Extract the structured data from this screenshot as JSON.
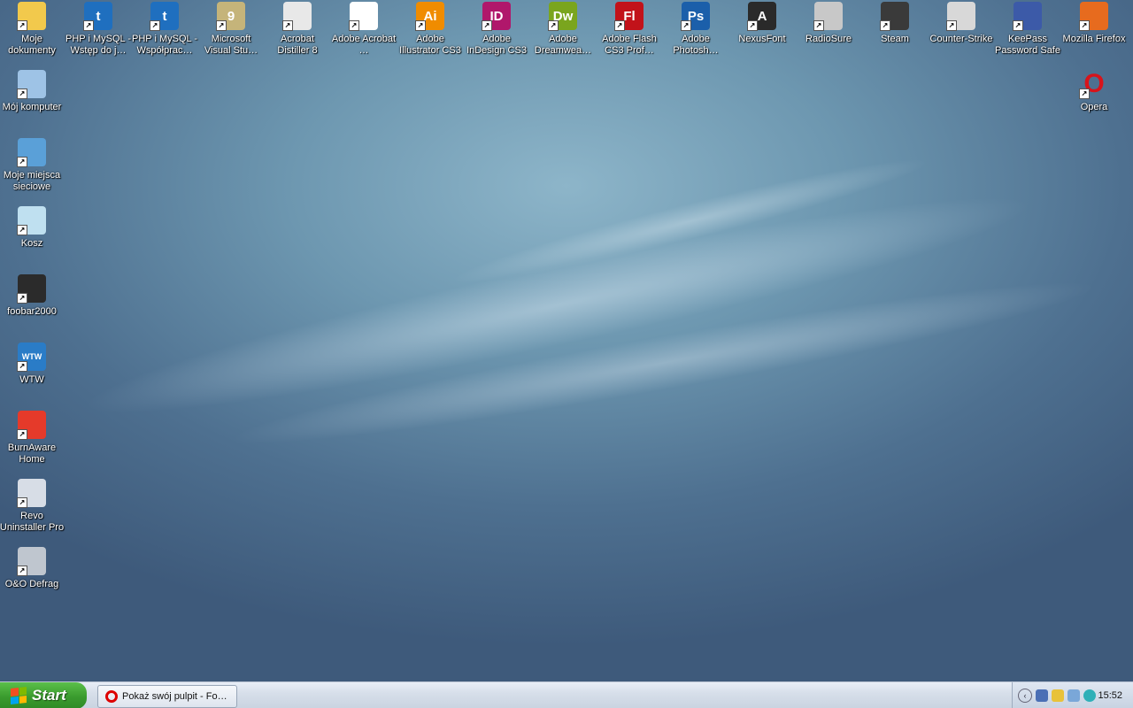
{
  "desktop": {
    "icons_top": [
      {
        "label": "Moje dokumenty",
        "icon": "folder-icon",
        "color": "#f2c94c",
        "text": ""
      },
      {
        "label": "PHP i MySQL - Wstęp do j…",
        "icon": "book-t-icon",
        "color": "#1f6fbf",
        "text": "t"
      },
      {
        "label": "PHP i MySQL - Współprac…",
        "icon": "book-t-icon",
        "color": "#1f6fbf",
        "text": "t"
      },
      {
        "label": "Microsoft Visual Stu…",
        "icon": "visual-studio-icon",
        "color": "#c5b47a",
        "text": "9"
      },
      {
        "label": "Acrobat Distiller 8",
        "icon": "acrobat-distiller-icon",
        "color": "#e8e8e8",
        "text": ""
      },
      {
        "label": "Adobe Acrobat …",
        "icon": "acrobat-icon",
        "color": "#ffffff",
        "text": ""
      },
      {
        "label": "Adobe Illustrator CS3",
        "icon": "illustrator-icon",
        "color": "#f08c00",
        "text": "Ai"
      },
      {
        "label": "Adobe InDesign CS3",
        "icon": "indesign-icon",
        "color": "#b0176b",
        "text": "ID"
      },
      {
        "label": "Adobe Dreamwea…",
        "icon": "dreamweaver-icon",
        "color": "#7aa51e",
        "text": "Dw"
      },
      {
        "label": "Adobe Flash CS3 Prof…",
        "icon": "flash-icon",
        "color": "#c2121a",
        "text": "Fl"
      },
      {
        "label": "Adobe Photosh…",
        "icon": "photoshop-icon",
        "color": "#1b5faa",
        "text": "Ps"
      },
      {
        "label": "NexusFont",
        "icon": "nexusfont-icon",
        "color": "#2a2a2a",
        "text": "A"
      },
      {
        "label": "RadioSure",
        "icon": "speaker-icon",
        "color": "#c8c8c8",
        "text": ""
      },
      {
        "label": "Steam",
        "icon": "steam-icon",
        "color": "#3a3a3a",
        "text": ""
      },
      {
        "label": "Counter-Strike",
        "icon": "counter-strike-icon",
        "color": "#d8d8d8",
        "text": ""
      },
      {
        "label": "KeePass Password Safe",
        "icon": "lock-icon",
        "color": "#3c5aa8",
        "text": ""
      },
      {
        "label": "Mozilla Firefox",
        "icon": "firefox-icon",
        "color": "#e76b1e",
        "text": ""
      }
    ],
    "icons_left": [
      {
        "label": "Mój komputer",
        "icon": "computer-icon",
        "color": "#9ec3e6",
        "text": ""
      },
      {
        "label": "Moje miejsca sieciowe",
        "icon": "network-icon",
        "color": "#5aa0d8",
        "text": ""
      },
      {
        "label": "Kosz",
        "icon": "recycle-bin-icon",
        "color": "#bfe0f0",
        "text": ""
      },
      {
        "label": "foobar2000",
        "icon": "foobar-icon",
        "color": "#2b2b2b",
        "text": ""
      },
      {
        "label": "WTW",
        "icon": "wtw-icon",
        "color": "#2a7cc7",
        "text": "WTW"
      },
      {
        "label": "BurnAware Home",
        "icon": "burnaware-icon",
        "color": "#e53a2a",
        "text": ""
      },
      {
        "label": "Revo Uninstaller Pro",
        "icon": "revo-icon",
        "color": "#d7dde6",
        "text": ""
      },
      {
        "label": "O&O Defrag",
        "icon": "defrag-icon",
        "color": "#bfc6cf",
        "text": ""
      }
    ],
    "icon_right": {
      "label": "Opera",
      "icon": "opera-icon",
      "color": "#d7141b",
      "text": "O"
    }
  },
  "taskbar": {
    "start_label": "Start",
    "window_button": "Pokaż swój pulpit - Fo…",
    "clock": "15:52"
  }
}
